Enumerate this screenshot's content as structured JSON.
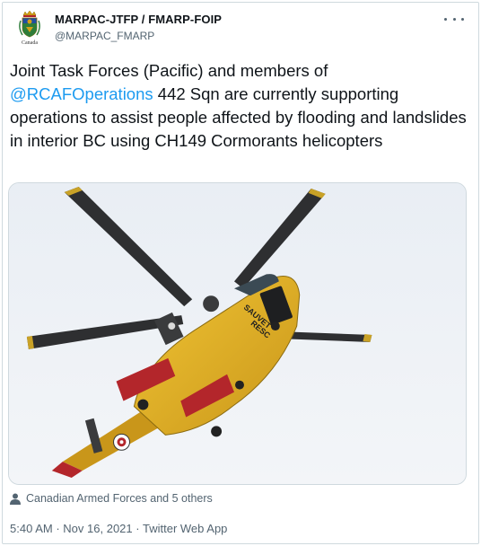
{
  "tweet": {
    "display_name": "MARPAC-JTFP / FMARP-FOIP",
    "handle": "@MARPAC_FMARP",
    "avatar_caption": "Canada",
    "text_before": "Joint Task Forces (Pacific) and members of ",
    "mention": "@RCAFOperations",
    "text_after": " 442 Sqn  are currently supporting operations to assist people affected by flooding and landslides in interior BC using CH149 Cormorants helicopters",
    "image_markings": {
      "side_text": "SAUVET",
      "side_text2": "RESC"
    },
    "tagged": "Canadian Armed Forces and 5 others",
    "time": "5:40 AM",
    "separator": "·",
    "date": "Nov 16, 2021",
    "source": "Twitter Web App"
  },
  "colors": {
    "accent": "#1d9bf0",
    "secondary_text": "#536471",
    "helicopter_yellow": "#e8b820",
    "helicopter_red": "#b3262b",
    "sky": "#eef2f6"
  },
  "icons": {
    "more": "more-horizontal-icon",
    "tagged": "person-icon",
    "avatar": "crest-logo"
  }
}
